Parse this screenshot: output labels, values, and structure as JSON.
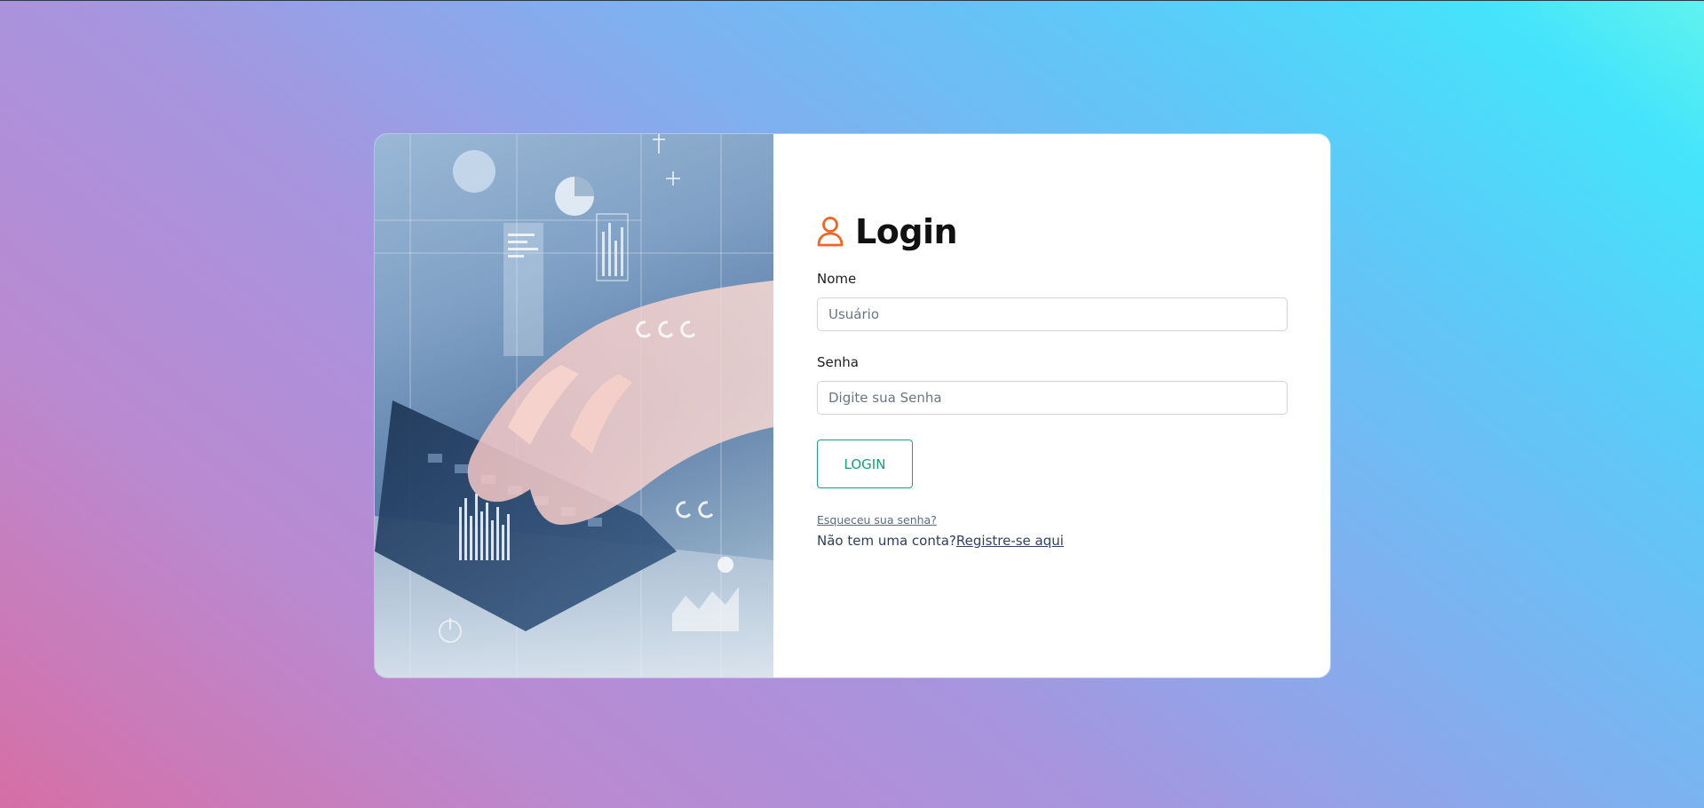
{
  "login": {
    "title": "Login",
    "icon": "user-icon",
    "accent_color": "#f26422",
    "username": {
      "label": "Nome",
      "placeholder": "Usuário",
      "value": ""
    },
    "password": {
      "label": "Senha",
      "placeholder": "Digite sua Senha",
      "value": ""
    },
    "submit_label": "LOGIN",
    "submit_color": "#1aa37e",
    "forgot_label": "Esqueceu sua senha?",
    "register_prompt": "Não tem uma conta?",
    "register_link": "Registre-se aqui"
  },
  "hero_image": {
    "icon": "hands-typing-keyboard-image"
  }
}
